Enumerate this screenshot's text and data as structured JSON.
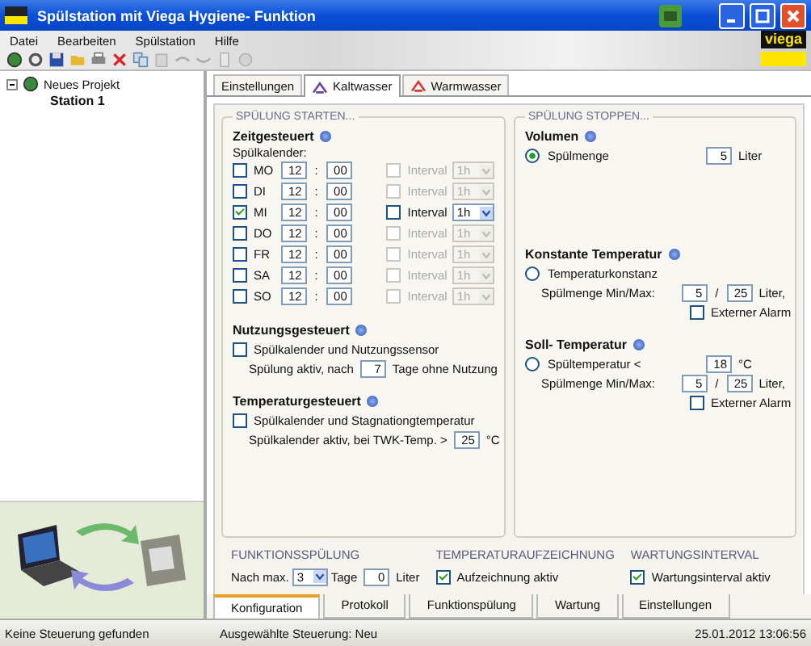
{
  "window": {
    "title": "Spülstation mit Viega Hygiene- Funktion"
  },
  "menu": [
    {
      "label": "Datei"
    },
    {
      "label": "Bearbeiten"
    },
    {
      "label": "Spülstation"
    },
    {
      "label": "Hilfe"
    }
  ],
  "logo": {
    "text": "viega"
  },
  "tree": [
    {
      "label": "Neues Projekt",
      "expanded": true,
      "children": [
        {
          "label": "Station 1"
        }
      ]
    }
  ],
  "top_tabs": [
    {
      "label": "Einstellungen",
      "selected": false,
      "kind": "plain"
    },
    {
      "label": "Kaltwasser",
      "selected": true,
      "kind": "cold"
    },
    {
      "label": "Warmwasser",
      "selected": false,
      "kind": "warm"
    }
  ],
  "start_group": {
    "title": "SPÜLUNG STARTEN...",
    "time": {
      "title": "Zeitgesteuert",
      "calendar_label": "Spülkalender:",
      "days": [
        {
          "day": "MO",
          "checked": false,
          "hour": "12",
          "separator": ":",
          "minute": "00",
          "interval_checked": false,
          "interval_label": "Interval",
          "interval_value": "1h",
          "interval_enabled": false
        },
        {
          "day": "DI",
          "checked": false,
          "hour": "12",
          "separator": ":",
          "minute": "00",
          "interval_checked": false,
          "interval_label": "Interval",
          "interval_value": "1h",
          "interval_enabled": false
        },
        {
          "day": "MI",
          "checked": true,
          "hour": "12",
          "separator": ":",
          "minute": "00",
          "interval_checked": false,
          "interval_label": "Interval",
          "interval_value": "1h",
          "interval_enabled": true
        },
        {
          "day": "DO",
          "checked": false,
          "hour": "12",
          "separator": ":",
          "minute": "00",
          "interval_checked": false,
          "interval_label": "Interval",
          "interval_value": "1h",
          "interval_enabled": false
        },
        {
          "day": "FR",
          "checked": false,
          "hour": "12",
          "separator": ":",
          "minute": "00",
          "interval_checked": false,
          "interval_label": "Interval",
          "interval_value": "1h",
          "interval_enabled": false
        },
        {
          "day": "SA",
          "checked": false,
          "hour": "12",
          "separator": ":",
          "minute": "00",
          "interval_checked": false,
          "interval_label": "Interval",
          "interval_value": "1h",
          "interval_enabled": false
        },
        {
          "day": "SO",
          "checked": false,
          "hour": "12",
          "separator": ":",
          "minute": "00",
          "interval_checked": false,
          "interval_label": "Interval",
          "interval_value": "1h",
          "interval_enabled": false
        }
      ]
    },
    "usage": {
      "title": "Nutzungsgesteuert",
      "checkbox": {
        "label": "Spülkalender und Nutzungssensor",
        "checked": false
      },
      "before": "Spülung aktiv, nach",
      "value": "7",
      "after": "Tage ohne Nutzung"
    },
    "temperature": {
      "title": "Temperaturgesteuert",
      "checkbox": {
        "label": "Spülkalender und Stagnationgtemperatur",
        "checked": false
      },
      "before": "Spülkalender aktiv, bei TWK-Temp. >",
      "value": "25",
      "after": "°C"
    }
  },
  "stop_group": {
    "title": "SPÜLUNG STOPPEN...",
    "volume": {
      "title": "Volumen",
      "radio": {
        "label": "Spülmenge",
        "selected": true
      },
      "value": "5",
      "unit": "Liter"
    },
    "constant": {
      "title": "Konstante Temperatur",
      "radio": {
        "label": "Temperaturkonstanz",
        "selected": false
      },
      "minmax_label": "Spülmenge Min/Max:",
      "min": "5",
      "separator": "/",
      "max": "25",
      "unit": "Liter,",
      "alarm": {
        "label": "Externer Alarm",
        "checked": false
      }
    },
    "target": {
      "title": "Soll- Temperatur",
      "radio": {
        "label": "Spültemperatur <",
        "selected": false
      },
      "value": "18",
      "value_unit": "°C",
      "minmax_label": "Spülmenge Min/Max:",
      "min": "5",
      "separator": "/",
      "max": "25",
      "unit": "Liter,",
      "alarm": {
        "label": "Externer Alarm",
        "checked": false
      }
    }
  },
  "bottom": {
    "function_flush": {
      "title": "FUNKTIONSSPÜLUNG",
      "prefix": "Nach max.",
      "days": "3",
      "days_unit": "Tage",
      "liters": "0",
      "liters_unit": "Liter"
    },
    "recording": {
      "title": "TEMPERATURAUFZEICHNUNG",
      "checkbox": {
        "label": "Aufzeichnung aktiv",
        "checked": true
      }
    },
    "maintenance": {
      "title": "WARTUNGSINTERVAL",
      "checkbox": {
        "label": "Wartungsinterval aktiv",
        "checked": true
      }
    }
  },
  "bottom_tabs": [
    {
      "label": "Konfiguration",
      "selected": true
    },
    {
      "label": "Protokoll",
      "selected": false
    },
    {
      "label": "Funktionspülung",
      "selected": false
    },
    {
      "label": "Wartung",
      "selected": false
    },
    {
      "label": "Einstellungen",
      "selected": false
    }
  ],
  "status_bar": [
    {
      "text": "Keine Steuerung gefunden"
    },
    {
      "text": "Ausgewählte Steuerung: Neu"
    },
    {
      "text": "25.01.2012 13:06:56"
    }
  ]
}
